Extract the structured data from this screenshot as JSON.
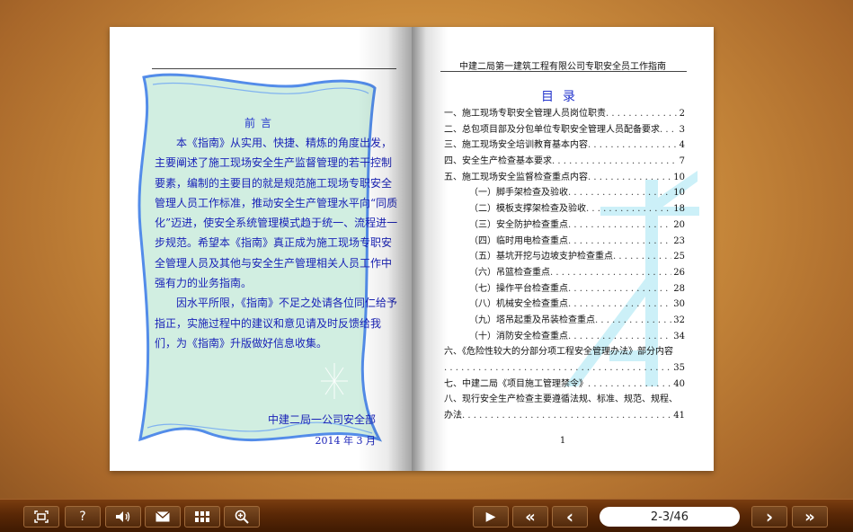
{
  "left_page": {
    "preface_title": "前言",
    "preface_paragraphs": [
      "本《指南》从实用、快捷、精炼的角度出发，主要阐述了施工现场安全生产监督管理的若干控制要素，编制的主要目的就是规范施工现场专职安全管理人员工作标准，推动安全生产管理水平向“同质化”迈进，使安全系统管理模式趋于统一、流程进一步规范。希望本《指南》真正成为施工现场专职安全管理人员及其他与安全生产管理相关人员工作中强有力的业务指南。",
      "因水平所限，《指南》不足之处请各位同仁给予指正，实施过程中的建议和意见请及时反馈给我们，为《指南》升版做好信息收集。"
    ],
    "signature_org": "中建二局一公司安全部",
    "signature_date": "2014 年 3 月"
  },
  "right_page": {
    "running_header": "中建二局第一建筑工程有限公司专职安全员工作指南",
    "toc_title": "目录",
    "toc": [
      {
        "title": "一、施工现场专职安全管理人员岗位职责",
        "page": "2",
        "sub": false
      },
      {
        "title": "二、总包项目部及分包单位专职安全管理人员配备要求",
        "page": "3",
        "sub": false
      },
      {
        "title": "三、施工现场安全培训教育基本内容",
        "page": "4",
        "sub": false
      },
      {
        "title": "四、安全生产检查基本要求",
        "page": "7",
        "sub": false
      },
      {
        "title": "五、施工现场安全监督检查重点内容",
        "page": "10",
        "sub": false
      },
      {
        "title": "（一）脚手架检查及验收",
        "page": "10",
        "sub": true
      },
      {
        "title": "（二）模板支撑架检查及验收",
        "page": "18",
        "sub": true
      },
      {
        "title": "（三）安全防护检查重点",
        "page": "20",
        "sub": true
      },
      {
        "title": "（四）临时用电检查重点",
        "page": "23",
        "sub": true
      },
      {
        "title": "（五）基坑开挖与边坡支护检查重点",
        "page": "25",
        "sub": true
      },
      {
        "title": "（六）吊篮检查重点",
        "page": "26",
        "sub": true
      },
      {
        "title": "（七）操作平台检查重点",
        "page": "28",
        "sub": true
      },
      {
        "title": "（八）机械安全检查重点",
        "page": "30",
        "sub": true
      },
      {
        "title": "（九）塔吊起重及吊装检查重点",
        "page": "32",
        "sub": true
      },
      {
        "title": "（十）消防安全检查重点",
        "page": "34",
        "sub": true
      }
    ],
    "toc_item_six_line1": "六、《危险性较大的分部分项工程安全管理办法》部分内容",
    "toc_item_six_page": "35",
    "toc_item_seven": {
      "title": "七、中建二局《项目施工管理禁令》",
      "page": "40"
    },
    "toc_item_eight_line1": "八、现行安全生产检查主要遵循法规、标准、规范、规程、",
    "toc_item_eight_line2": "办法",
    "toc_item_eight_page": "41",
    "page_number": "1"
  },
  "toolbar": {
    "fit_icon": "fit-screen-icon",
    "help_label": "?",
    "sound_icon": "speaker-icon",
    "email_icon": "envelope-icon",
    "thumbnails_icon": "thumbnails-icon",
    "zoom_icon": "zoom-in-icon",
    "play_label": "▶",
    "first_label": "«",
    "prev_label": "‹",
    "page_indicator": "2-3/46",
    "next_label": "›",
    "last_label": "»"
  },
  "colors": {
    "preface_text": "#1a22b8",
    "toolbar_bg": "#5a2806",
    "frame_stroke": "#4a86e8",
    "frame_fill": "#cfeee0"
  }
}
